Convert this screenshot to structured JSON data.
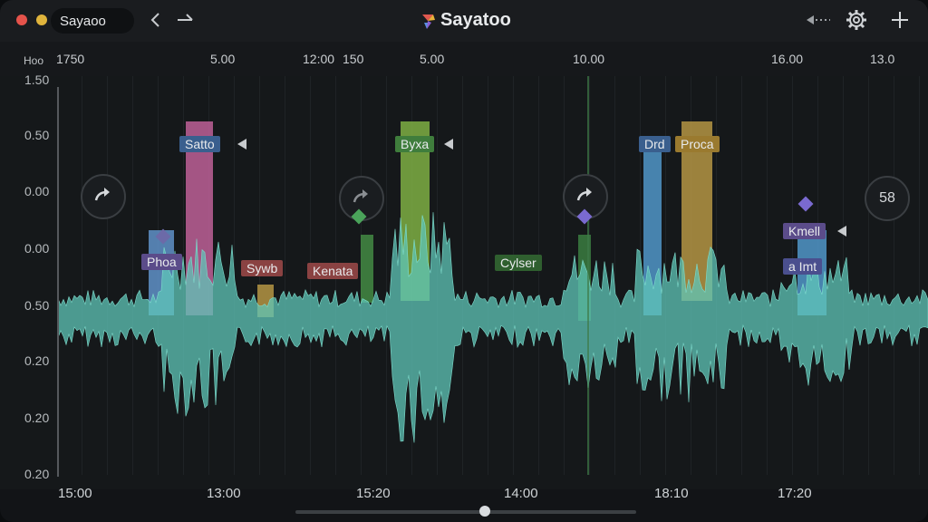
{
  "titlebar": {
    "tab_label": "Sayaoo",
    "app_title": "Sayatoo",
    "colors": {
      "close": "#e5534b",
      "minimize": "#e0b43c"
    },
    "icons": [
      "back-arrow-icon",
      "forward-arrow-icon",
      "rewind-icon",
      "gear-icon",
      "plus-icon"
    ]
  },
  "ruler": {
    "left_label": "Hoo",
    "labels": [
      "1750",
      "5.00",
      "12:00",
      "150",
      "5.00",
      "10.00",
      "16.00",
      "13.0"
    ]
  },
  "y_axis": {
    "labels": [
      "1.50",
      "0.50",
      "0.00",
      "0.00",
      "0.50",
      "0.20",
      "0.20",
      "0.20"
    ]
  },
  "x_axis": {
    "labels": [
      "15:00",
      "13:00",
      "15:20",
      "14:00",
      "18:10",
      "17:20"
    ]
  },
  "circle_buttons": {
    "count_label": "58"
  },
  "markers": {
    "satto": "Satto",
    "phoa": "Phoa",
    "sywb": "Sywb",
    "kenata": "Kenata",
    "byxa": "Byxa",
    "cyusr": "Cylser",
    "drd": "Drd",
    "proca": "Proca",
    "kmell": "Kmell",
    "aimt": "a Imt"
  },
  "colors": {
    "wave": "#5fc6b8",
    "accent_pink": "#d86aa0",
    "accent_green": "#8cc34a",
    "accent_yellow": "#c9a64a",
    "accent_blue": "#58a7e0",
    "accent_purple": "#8b6fc7"
  }
}
